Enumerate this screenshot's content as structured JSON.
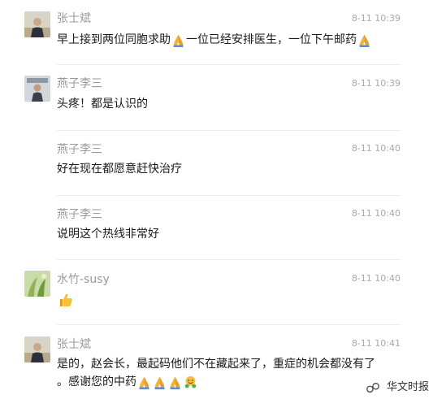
{
  "messages": [
    {
      "name": "张士斌",
      "time": "8-11 10:39",
      "text_parts": [
        "早上接到两位同胞求助",
        "一位已经安排医生，一位下午邮药"
      ],
      "icons": [
        "folded-hands-icon",
        "folded-hands-icon"
      ]
    },
    {
      "name": "燕子李三",
      "time": "8-11 10:39",
      "text": "头疼！都是认识的"
    },
    {
      "name": "燕子李三",
      "time": "8-11 10:40",
      "text": "好在现在都愿意赶快治疗"
    },
    {
      "name": "燕子李三",
      "time": "8-11 10:40",
      "text": "说明这个热线非常好"
    },
    {
      "name": "水竹-susy",
      "time": "8-11 10:40",
      "icons": [
        "thumbs-up-icon"
      ]
    },
    {
      "name": "张士斌",
      "time": "8-11 10:41",
      "line1": "是的，赵会长，最起码他们不在藏起来了，重症的机会都没有了",
      "line2": "。感谢您的中药",
      "icons": [
        "folded-hands-icon",
        "folded-hands-icon",
        "folded-hands-icon",
        "hugging-face-icon"
      ]
    }
  ],
  "watermark": {
    "text": "华文时报",
    "icon": "wechat-channel-icon"
  },
  "colors": {
    "name": "#9a9a9a",
    "text": "#1a1a1a",
    "time": "#a8a8a8",
    "divider": "#ececec"
  }
}
